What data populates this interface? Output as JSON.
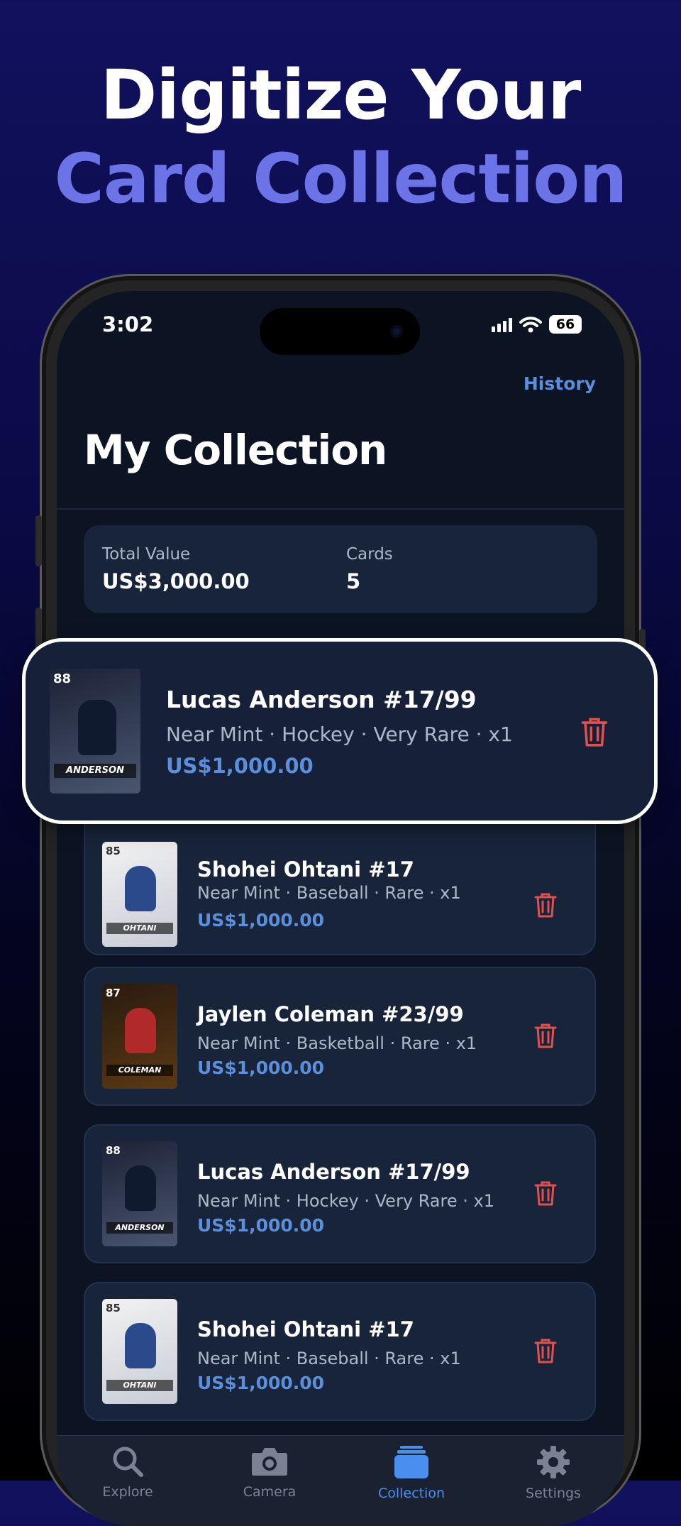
{
  "headline": {
    "line1": "Digitize Your",
    "line2": "Card Collection"
  },
  "status_bar": {
    "time": "3:02",
    "battery": "66"
  },
  "header": {
    "history_label": "History",
    "title": "My Collection"
  },
  "summary": {
    "total_value_label": "Total Value",
    "total_value": "US$3,000.00",
    "cards_label": "Cards",
    "cards_count": "5"
  },
  "highlighted_card": {
    "name": "Lucas Anderson #17/99",
    "meta": "Near Mint · Hockey · Very Rare · x1",
    "price": "US$1,000.00",
    "rating": "88",
    "nameplate": "ANDERSON"
  },
  "cards": [
    {
      "name": "Shohei Ohtani #17",
      "meta": "Near Mint · Baseball · Rare · x1",
      "price": "US$1,000.00",
      "rating": "85",
      "nameplate": "OHTANI"
    },
    {
      "name": "Jaylen Coleman #23/99",
      "meta": "Near Mint · Basketball · Rare · x1",
      "price": "US$1,000.00",
      "rating": "87",
      "nameplate": "COLEMAN"
    },
    {
      "name": "Lucas Anderson #17/99",
      "meta": "Near Mint · Hockey · Very Rare · x1",
      "price": "US$1,000.00",
      "rating": "88",
      "nameplate": "ANDERSON"
    },
    {
      "name": "Shohei Ohtani #17",
      "meta": "Near Mint · Baseball · Rare · x1",
      "price": "US$1,000.00",
      "rating": "85",
      "nameplate": "OHTANI"
    }
  ],
  "tabs": [
    {
      "label": "Explore",
      "icon": "search-icon"
    },
    {
      "label": "Camera",
      "icon": "camera-icon"
    },
    {
      "label": "Collection",
      "icon": "collection-icon",
      "active": true
    },
    {
      "label": "Settings",
      "icon": "gear-icon"
    }
  ],
  "colors": {
    "accent": "#5b8fdc",
    "headline_accent": "#6b73e6",
    "delete": "#e0504f",
    "active_tab": "#4a8ff0"
  }
}
